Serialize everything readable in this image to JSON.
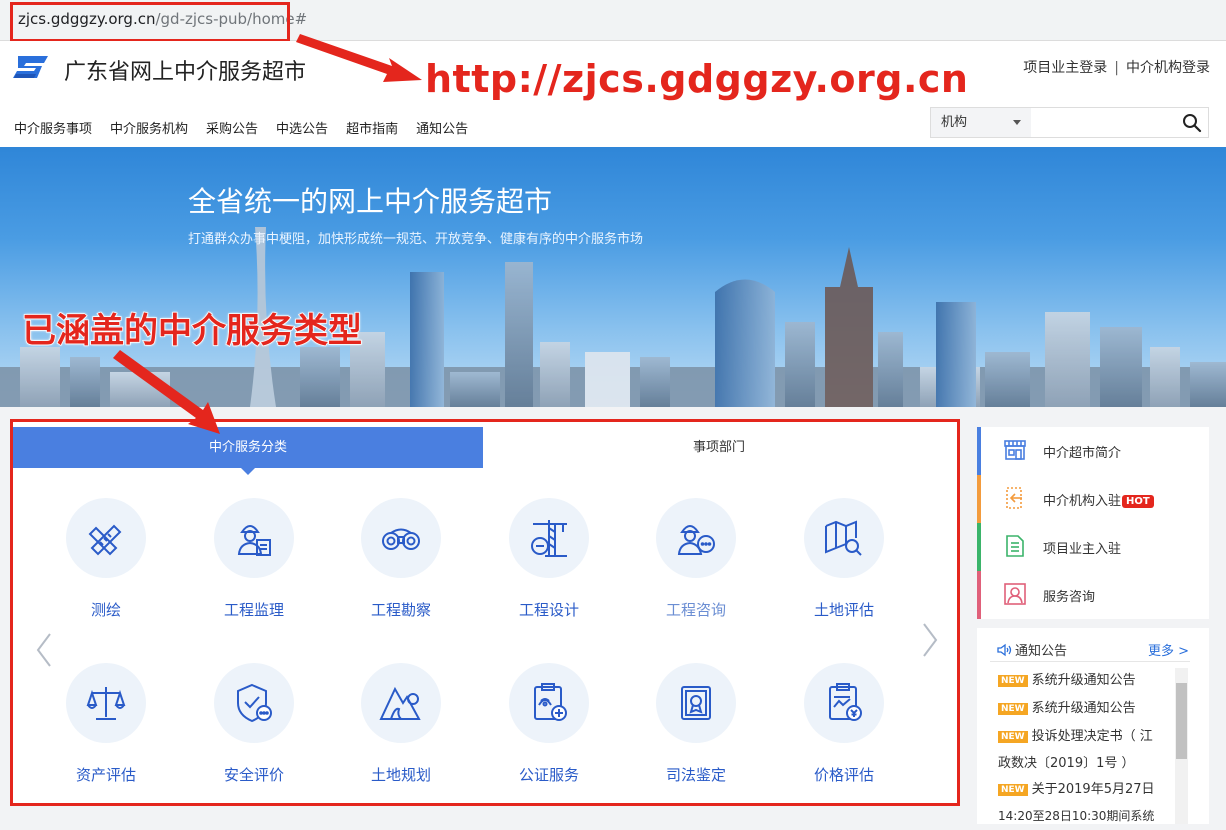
{
  "address_bar": {
    "host": "zjcs.gdggzy.org.cn",
    "path": "/gd-zjcs-pub/home#"
  },
  "header": {
    "site_title": "广东省网上中介服务超市",
    "annotation_url": "http://zjcs.gdggzy.org.cn",
    "login_owner": "项目业主登录",
    "login_separator": "|",
    "login_agency": "中介机构登录"
  },
  "nav": [
    "中介服务事项",
    "中介服务机构",
    "采购公告",
    "中选公告",
    "超市指南",
    "通知公告"
  ],
  "search": {
    "selected": "机构",
    "placeholder": ""
  },
  "banner": {
    "title": "全省统一的网上中介服务超市",
    "subtitle": "打通群众办事中梗阻，加快形成统一规范、开放竞争、健康有序的中介服务市场",
    "annotation": "已涵盖的中介服务类型"
  },
  "tabs": {
    "category": "中介服务分类",
    "department": "事项部门"
  },
  "services": [
    {
      "label": "测绘",
      "icon": "ruler-pencil-icon"
    },
    {
      "label": "工程监理",
      "icon": "worker-document-icon"
    },
    {
      "label": "工程勘察",
      "icon": "binoculars-icon"
    },
    {
      "label": "工程设计",
      "icon": "crane-icon"
    },
    {
      "label": "工程咨询",
      "icon": "worker-chat-icon"
    },
    {
      "label": "土地评估",
      "icon": "map-search-icon"
    },
    {
      "label": "资产评估",
      "icon": "balance-scale-icon"
    },
    {
      "label": "安全评价",
      "icon": "shield-check-icon"
    },
    {
      "label": "土地规划",
      "icon": "mountain-icon"
    },
    {
      "label": "公证服务",
      "icon": "clipboard-plus-icon"
    },
    {
      "label": "司法鉴定",
      "icon": "certificate-icon"
    },
    {
      "label": "价格评估",
      "icon": "price-doc-icon"
    }
  ],
  "sidebar": [
    {
      "label": "中介超市简介",
      "accent": "#4a7fe0",
      "icon": "shop-icon",
      "hot": ""
    },
    {
      "label": "中介机构入驻",
      "accent": "#f39b3d",
      "icon": "login-icon",
      "hot": "HOT"
    },
    {
      "label": "项目业主入驻",
      "accent": "#3bb46a",
      "icon": "document-icon",
      "hot": ""
    },
    {
      "label": "服务咨询",
      "accent": "#e0607a",
      "icon": "consultant-icon",
      "hot": ""
    }
  ],
  "notice": {
    "title": "通知公告",
    "more": "更多 >",
    "badge": "NEW",
    "items": [
      {
        "line1": "系统升级通知公告",
        "line2": ""
      },
      {
        "line1": "系统升级通知公告",
        "line2": ""
      },
      {
        "line1": "投诉处理决定书（ 江",
        "line2": "政数决〔2019〕1号 ）"
      },
      {
        "line1": "关于2019年5月27日",
        "line2": "14:20至28日10:30期间系统"
      }
    ]
  },
  "colors": {
    "accent": "#4a7fe0",
    "annotation_red": "#e4261d",
    "icon_blue": "#2a5bc8"
  }
}
